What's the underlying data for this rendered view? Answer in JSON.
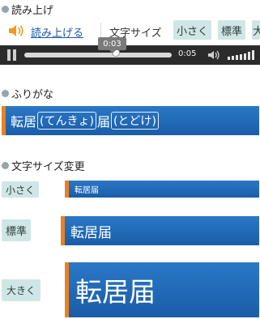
{
  "sections": {
    "read_aloud_heading": "読み上げ",
    "furigana_heading": "ふりがな",
    "font_change_heading": "文字サイズ変更"
  },
  "toolbar": {
    "read_aloud_link": "読み上げる",
    "font_size_label": "文字サイズ",
    "small_button": "小さく",
    "standard_button": "標準",
    "large_button_partial": "大"
  },
  "player": {
    "tooltip_time": "0:03",
    "current_time": "0:05",
    "progress_fraction": 0.62
  },
  "furigana_demo": {
    "part1_kanji": "転居",
    "part1_reading": "てんきょ",
    "part2_kanji": "届",
    "part2_reading": "とどけ"
  },
  "size_demo": {
    "small_label": "小さく",
    "standard_label": "標準",
    "large_label": "大きく",
    "sample_text": "転居届"
  },
  "colors": {
    "accent_orange": "#e8821f",
    "bar_blue": "#1f6cba",
    "button_teal": "#cfe6e6",
    "link_blue": "#1b56a8"
  }
}
